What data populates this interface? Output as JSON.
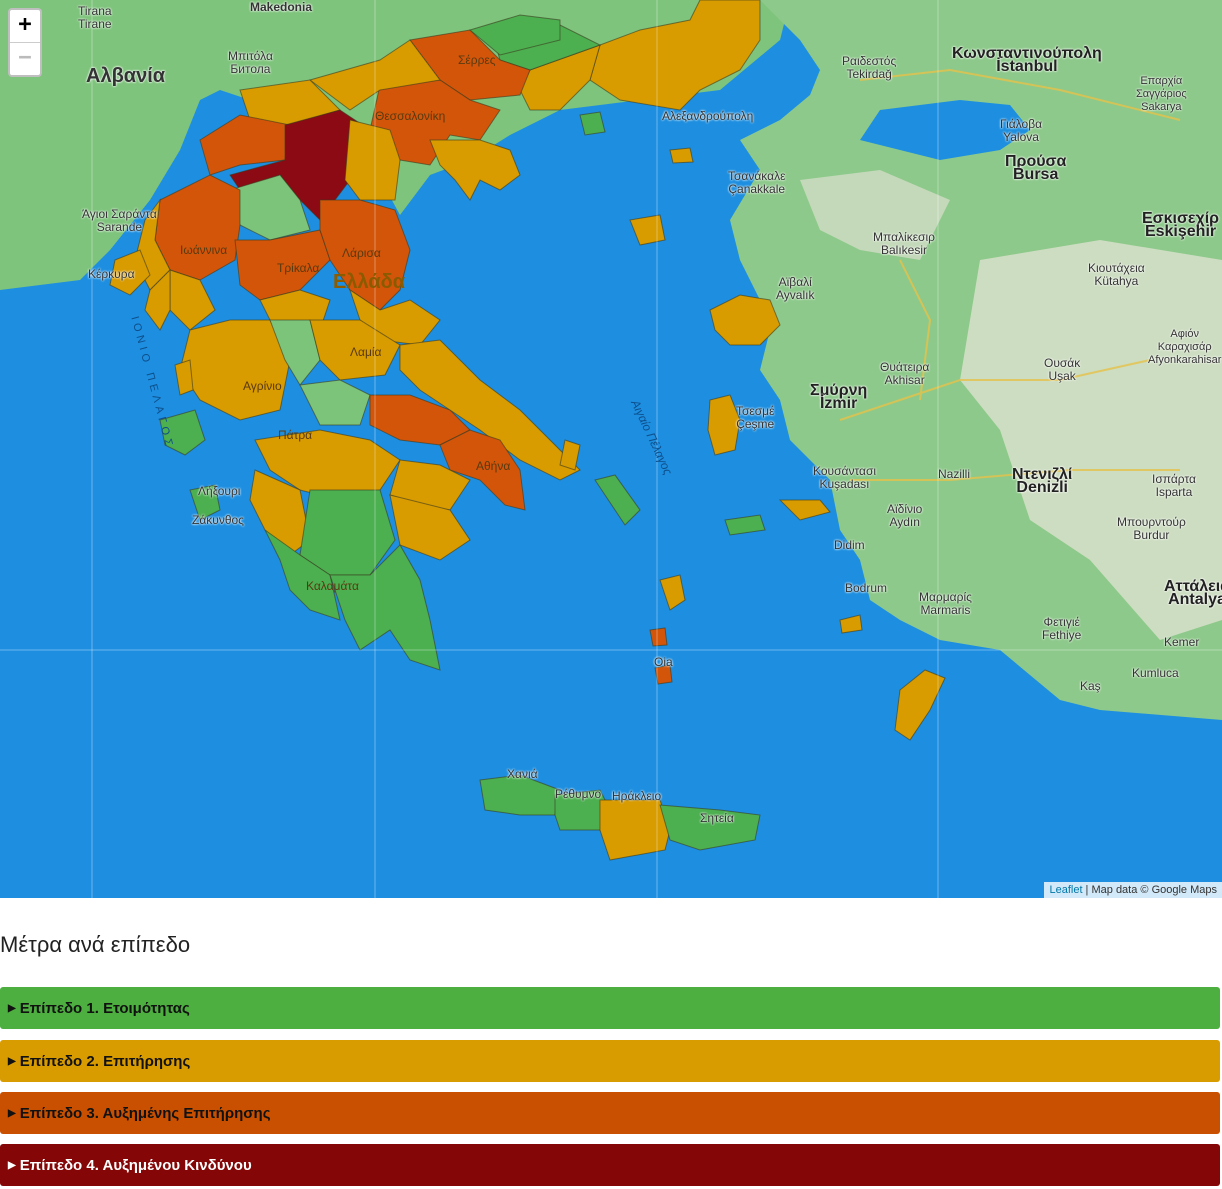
{
  "map": {
    "zoom_in_label": "+",
    "zoom_out_label": "−",
    "attribution": {
      "leaflet": "Leaflet",
      "separator": " | ",
      "map_data": "Map data © Google Maps"
    },
    "colors": {
      "sea": "#1e8fe0",
      "land": "#7cc47a",
      "level1": "#4caf50",
      "level2": "#d4a017",
      "level3": "#d2550a",
      "level4": "#8b0a14"
    },
    "labels": {
      "tirana": "Tirana\nTirane",
      "makedonia": "Makedonia",
      "albania": "Αλβανία",
      "bitola": "Μπιτόλα\nБитола",
      "agioi_saranta": "Άγιοι Σαράντα\nSarande",
      "kerkyra": "Κέρκυρα",
      "ioannina": "Ιωάννινα",
      "trikala": "Τρίκαλα",
      "larisa": "Λάρισα",
      "ellada": "Ελλάδα",
      "thessaloniki": "Θεσσαλονίκη",
      "serres": "Σέρρες",
      "alexandroupoli": "Αλεξανδρούπολη",
      "lamia": "Λαμία",
      "agrinio": "Αγρίνιο",
      "patra": "Πάτρα",
      "athina": "Αθήνα",
      "lixouri": "Λήξουρι",
      "zakynthos": "Ζάκυνθος",
      "kalamata": "Καλαμάτα",
      "chania": "Χανιά",
      "rethymno": "Ρέθυμνο",
      "irakleio": "Ηράκλειο",
      "sitia": "Σητεία",
      "ionian": "ΙΟΝΙΟ ΠΕΛΑΓΟΣ",
      "aegean": "Αιγαίο Πέλαγος",
      "raidestos": "Ραιδεστός\nTekirdağ",
      "konstantinoupoli": "Κωνσταντινούπολη\nİstanbul",
      "sakarya": "Επαρχία\nΣαγγάριος\nSakarya",
      "giala": "Γιάλοβα\nYalova",
      "prousa": "Προύσα\nBursa",
      "eskisehir": "Εσκισεχίρ\nEskişehir",
      "canakkale": "Τσανάκαλε\nÇanakkale",
      "balikesir": "Μπαλίκεσιρ\nBalıkesir",
      "ayvalik": "Αϊβαλί\nAyvalık",
      "kutahya": "Κιουτάχεια\nKütahya",
      "afyon": "Αφιόν\nΚαραχισάρ\nAfyonkarahisar",
      "akhisar": "Θυάτειρα\nAkhisar",
      "usak": "Ουσάκ\nUşak",
      "smyrni": "Σμύρνη\nİzmir",
      "cesme": "Τσεσμέ\nÇeşme",
      "kusadasi": "Κουσάντασι\nKuşadası",
      "nazilli": "Nazilli",
      "denizli": "Ντενιζλί\nDenizli",
      "isparta": "Ισπάρτα\nIsparta",
      "aydin": "Αϊδίνιο\nAydın",
      "didim": "Didim",
      "burdur": "Μπουρντούρ\nBurdur",
      "bodrum": "Bodrum",
      "marmaris": "Μαρμαρίς\nMarmaris",
      "fethiye": "Φετιγιέ\nFethiye",
      "antalya": "Αττάλεια\nAntalya",
      "kemer": "Kemer",
      "kumluca": "Kumluca",
      "kas": "Kaş",
      "oia": "Oia",
      "didimoteicho": "Didim"
    }
  },
  "section_title": "Μέτρα ανά επίπεδο",
  "levels": [
    {
      "label": "Επίπεδο 1. Ετοιμότητας",
      "color": "#4caf3f"
    },
    {
      "label": "Επίπεδο 2. Επιτήρησης",
      "color": "#d89b00"
    },
    {
      "label": "Επίπεδο 3. Αυξημένης Επιτήρησης",
      "color": "#c95000"
    },
    {
      "label": "Επίπεδο 4. Αυξημένου Κινδύνου",
      "color": "#850606"
    }
  ]
}
